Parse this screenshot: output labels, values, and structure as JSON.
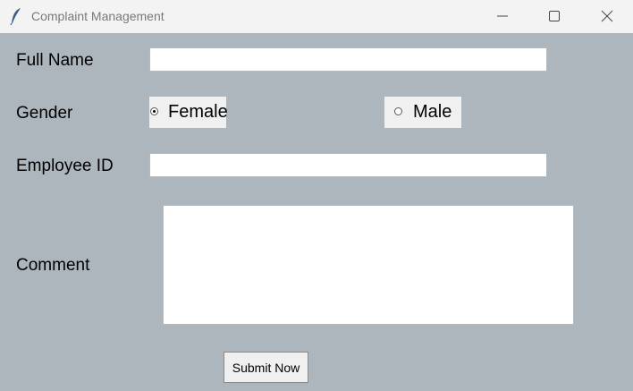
{
  "window": {
    "title": "Complaint Management",
    "icon": "feather-icon",
    "controls": {
      "minimize_icon": "minimize-icon",
      "maximize_icon": "maximize-icon",
      "close_icon": "close-icon"
    }
  },
  "form": {
    "full_name": {
      "label": "Full Name",
      "value": ""
    },
    "gender": {
      "label": "Gender",
      "options": [
        {
          "label": "Female",
          "selected": true
        },
        {
          "label": "Male",
          "selected": false
        }
      ]
    },
    "employee_id": {
      "label": "Employee ID",
      "value": ""
    },
    "comment": {
      "label": "Comment",
      "value": ""
    },
    "submit_label": "Submit Now"
  },
  "colors": {
    "titlebar_bg": "#f3f3f3",
    "content_bg": "#adb5bd",
    "radio_bg": "#f0f0f0",
    "button_bg": "#f0f0f0"
  }
}
